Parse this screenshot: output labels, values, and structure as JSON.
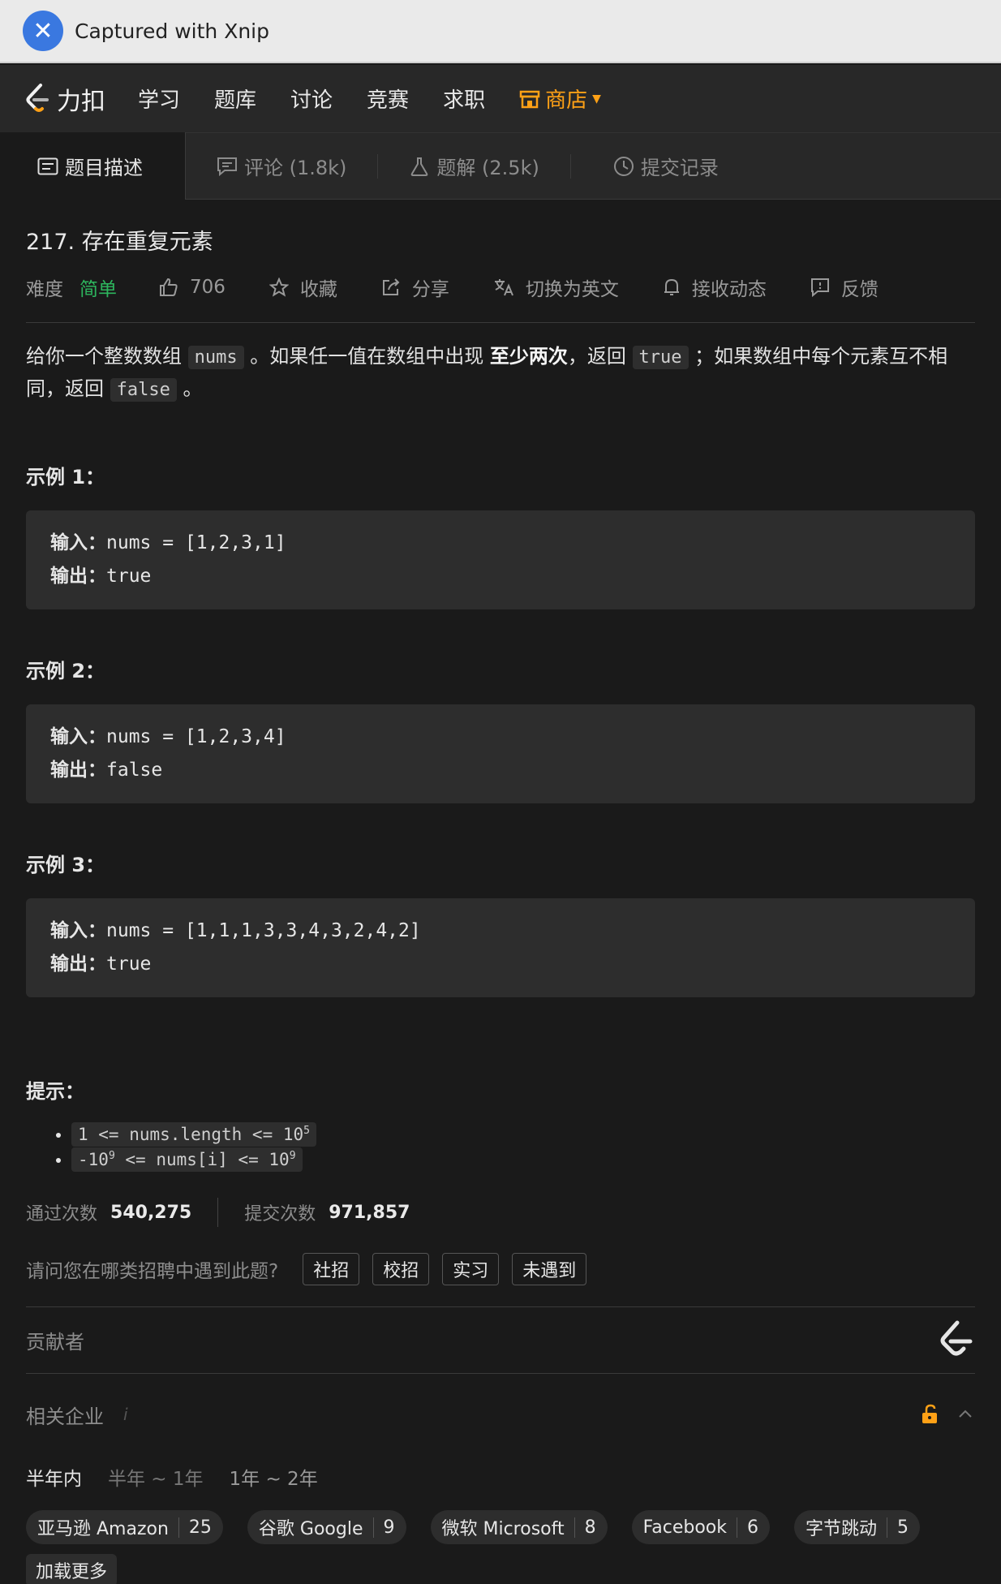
{
  "xnip": {
    "title": "Captured with Xnip"
  },
  "nav": {
    "brand": "力扣",
    "items": [
      "学习",
      "题库",
      "讨论",
      "竞赛",
      "求职"
    ],
    "store": "商店",
    "colors": {
      "accent": "#ffa116",
      "easy": "#2db55d"
    }
  },
  "tabs": [
    {
      "label": "题目描述",
      "icon": "document-icon"
    },
    {
      "label": "评论 (1.8k)",
      "icon": "comment-icon"
    },
    {
      "label": "题解 (2.5k)",
      "icon": "flask-icon"
    },
    {
      "label": "提交记录",
      "icon": "clock-icon"
    }
  ],
  "problem": {
    "title": "217. 存在重复元素",
    "difficulty_label": "难度",
    "difficulty": "简单",
    "likes": "706",
    "favorite": "收藏",
    "share": "分享",
    "switch_lang": "切换为英文",
    "subscribe": "接收动态",
    "feedback": "反馈",
    "desc": {
      "p1": "给你一个整数数组",
      "code_nums": "nums",
      "p2": "。如果任一值在数组中出现",
      "strong": "至少两次",
      "p3": "，返回",
      "code_true": "true",
      "p4": "；如果数组中每个元素互不相同，返回",
      "code_false": "false",
      "p5": "。"
    },
    "examples": [
      {
        "heading": "示例 1：",
        "in_label": "输入：",
        "input": "nums = [1,2,3,1]",
        "out_label": "输出：",
        "output": "true"
      },
      {
        "heading": "示例 2：",
        "in_label": "输入：",
        "input": "nums = [1,2,3,4]",
        "out_label": "输出：",
        "output": "false"
      },
      {
        "heading": "示例 3：",
        "in_label": "输入：",
        "input": "nums = [1,1,1,3,3,4,3,2,4,2]",
        "out_label": "输出：",
        "output": "true"
      }
    ],
    "hint_heading": "提示：",
    "hints": [
      {
        "pre": "1 <= nums.length <= 10",
        "sup": "5",
        "post": ""
      },
      {
        "pre": "-10",
        "sup": "9",
        "mid": " <= nums[i] <= 10",
        "sup2": "9"
      }
    ],
    "accepted_label": "通过次数",
    "accepted": "540,275",
    "submissions_label": "提交次数",
    "submissions": "971,857",
    "recruit_question": "请问您在哪类招聘中遇到此题?",
    "recruit_options": [
      "社招",
      "校招",
      "实习",
      "未遇到"
    ],
    "contributors": "贡献者",
    "companies_label": "相关企业",
    "companies_info": "i",
    "periods": [
      "半年内",
      "半年 ~ 1年",
      "1年 ~ 2年"
    ],
    "companies": [
      {
        "name": "亚马逊 Amazon",
        "count": "25"
      },
      {
        "name": "谷歌 Google",
        "count": "9"
      },
      {
        "name": "微软 Microsoft",
        "count": "8"
      },
      {
        "name": "Facebook",
        "count": "6"
      },
      {
        "name": "字节跳动",
        "count": "5"
      }
    ],
    "load_more": "加载更多"
  }
}
